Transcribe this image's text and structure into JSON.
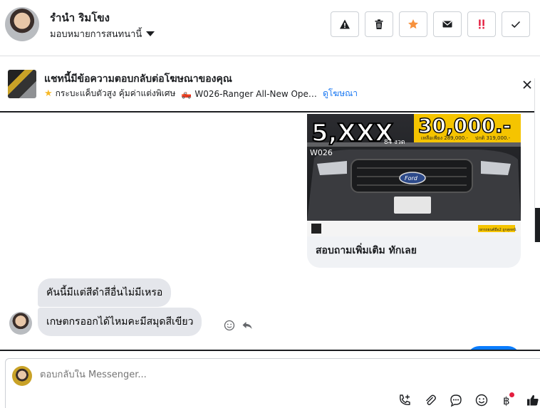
{
  "header": {
    "contact_name": "รำนำ ริมโขง",
    "assign_label": "มอบหมายการสนทนานี้",
    "actions": [
      {
        "name": "warning-button",
        "icon": "warning-icon"
      },
      {
        "name": "delete-button",
        "icon": "trash-icon"
      },
      {
        "name": "star-button",
        "icon": "star-icon"
      },
      {
        "name": "mail-button",
        "icon": "envelope-icon"
      },
      {
        "name": "urgent-button",
        "icon": "exclamation-icon"
      },
      {
        "name": "done-button",
        "icon": "check-icon"
      }
    ],
    "colors": {
      "star": "#f7923e",
      "urgent": "#e41e3f"
    }
  },
  "ad_notice": {
    "title": "แชทนี้มีข้อความตอบกลับต่อโฆษณาของคุณ",
    "subtitle": "กระบะแค็บตัวสูง คุ้มค่าแต่งพิเศษ",
    "subtitle_model": "W026-Ranger All-New Open C...",
    "link": "ดูโฆษณา"
  },
  "ad_card": {
    "price_small": "5,XXX",
    "months": "84 งวด",
    "price_big": "30,000.-",
    "remain": "เหลือเพียง 289,000.-",
    "full_price": "ปกติ 319,000.-",
    "code": "W026",
    "badge": "Ford",
    "plate": "",
    "dealer": "ยกรถยนต์มือ2 ถูกสุดหน้",
    "caption": "สอบถามเพิ่มเติม ทักเลย"
  },
  "messages": [
    {
      "text": "คันนี้มีแต่สีดำสีอื่นไม่มีเหรอ"
    },
    {
      "text": "เกษตกรออกได้ไหมคะมีสมุดสีเขียว"
    }
  ],
  "composer": {
    "placeholder": "ตอบกลับใน Messenger...",
    "icons": [
      "call-add-icon",
      "attachment-icon",
      "saved-reply-icon",
      "emoji-icon",
      "baht-icon",
      "thumbs-up-icon"
    ],
    "brand_blue": "#0a7cff"
  }
}
